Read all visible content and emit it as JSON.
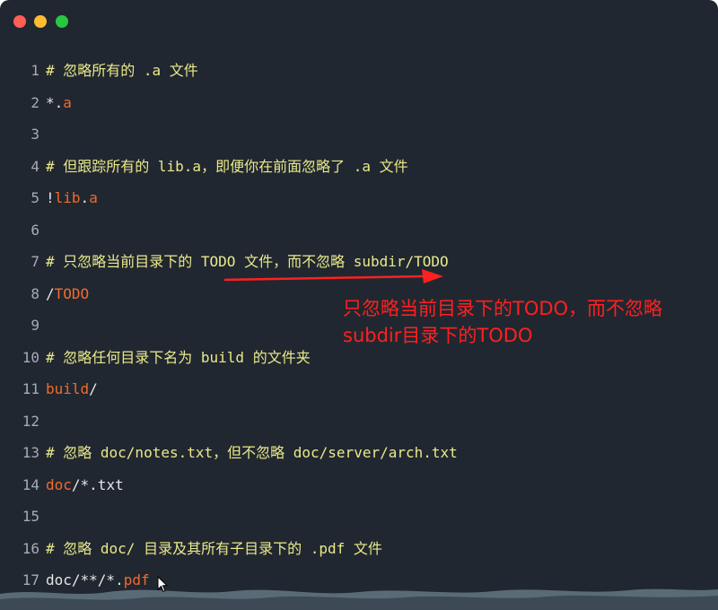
{
  "window": {
    "controls": [
      "close",
      "minimize",
      "maximize"
    ]
  },
  "colors": {
    "background": "#212730",
    "comment": "#e9e98a",
    "line_number": "#a6acb5",
    "pattern": "#f06b2e",
    "symbol": "#e6e6e6",
    "annotation": "#ff2020"
  },
  "lines": [
    {
      "num": "1",
      "tokens": [
        {
          "t": "# 忽略所有的 .a 文件",
          "c": "comment"
        }
      ]
    },
    {
      "num": "2",
      "tokens": [
        {
          "t": "*.",
          "c": "white"
        },
        {
          "t": "a",
          "c": "orange"
        }
      ]
    },
    {
      "num": "3",
      "tokens": []
    },
    {
      "num": "4",
      "tokens": [
        {
          "t": "# 但跟踪所有的 lib.a，即便你在前面忽略了 .a 文件",
          "c": "comment"
        }
      ]
    },
    {
      "num": "5",
      "tokens": [
        {
          "t": "!",
          "c": "white"
        },
        {
          "t": "lib",
          "c": "orange"
        },
        {
          "t": ".",
          "c": "white"
        },
        {
          "t": "a",
          "c": "orange"
        }
      ]
    },
    {
      "num": "6",
      "tokens": []
    },
    {
      "num": "7",
      "tokens": [
        {
          "t": "# 只忽略当前目录下的 TODO 文件，而不忽略 subdir/TODO",
          "c": "comment"
        }
      ]
    },
    {
      "num": "8",
      "tokens": [
        {
          "t": "/",
          "c": "white"
        },
        {
          "t": "TODO",
          "c": "orange"
        }
      ]
    },
    {
      "num": "9",
      "tokens": []
    },
    {
      "num": "10",
      "tokens": [
        {
          "t": "# 忽略任何目录下名为 build 的文件夹",
          "c": "comment"
        }
      ]
    },
    {
      "num": "11",
      "tokens": [
        {
          "t": "build",
          "c": "orange"
        },
        {
          "t": "/",
          "c": "white"
        }
      ]
    },
    {
      "num": "12",
      "tokens": []
    },
    {
      "num": "13",
      "tokens": [
        {
          "t": "# 忽略 doc/notes.txt，但不忽略 doc/server/arch.txt",
          "c": "comment"
        }
      ]
    },
    {
      "num": "14",
      "tokens": [
        {
          "t": "doc",
          "c": "orange"
        },
        {
          "t": "/*.txt",
          "c": "white"
        }
      ]
    },
    {
      "num": "15",
      "tokens": []
    },
    {
      "num": "16",
      "tokens": [
        {
          "t": "# 忽略 doc/ 目录及其所有子目录下的 .pdf 文件",
          "c": "comment"
        }
      ]
    },
    {
      "num": "17",
      "tokens": [
        {
          "t": "doc/**/*.",
          "c": "white"
        },
        {
          "t": "pdf",
          "c": "orange"
        }
      ]
    }
  ],
  "annotation": {
    "line1": "只忽略当前目录下的TODO，而不忽略",
    "line2": "subdir目录下的TODO"
  }
}
